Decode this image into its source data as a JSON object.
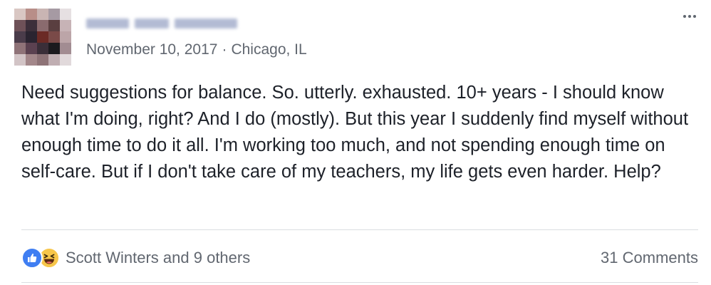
{
  "post": {
    "author": {
      "name_redacted": true
    },
    "date": "November 10, 2017",
    "separator": "·",
    "location": "Chicago, IL",
    "text": "Need suggestions for balance. So. utterly. exhausted. 10+ years - I should know what I'm doing, right? And I do (mostly). But this year I suddenly find myself without enough time to do it all. I'm working too much, and not spending enough time on self-care. But if I don't take care of my teachers, my life gets even harder. Help?",
    "more_icon": "more-horizontal-icon"
  },
  "footer": {
    "reaction_icons": [
      "like-icon",
      "haha-icon"
    ],
    "reaction_summary": "Scott Winters and 9 others",
    "comments_label": "31 Comments"
  },
  "colors": {
    "like": "#3f7ef2",
    "haha": "#f7c64a",
    "meta_text": "#616770",
    "body_text": "#1d2129",
    "divider": "#dadde1"
  }
}
